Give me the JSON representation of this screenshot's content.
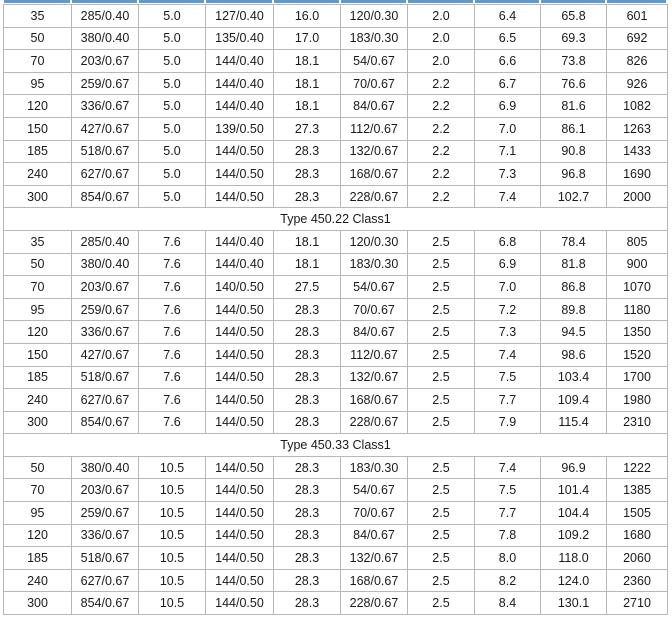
{
  "sections": [
    {
      "title": "",
      "rows": [
        [
          "35",
          "285/0.40",
          "5.0",
          "127/0.40",
          "16.0",
          "120/0.30",
          "2.0",
          "6.4",
          "65.8",
          "601"
        ],
        [
          "50",
          "380/0.40",
          "5.0",
          "135/0.40",
          "17.0",
          "183/0.30",
          "2.0",
          "6.5",
          "69.3",
          "692"
        ],
        [
          "70",
          "203/0.67",
          "5.0",
          "144/0.40",
          "18.1",
          "54/0.67",
          "2.0",
          "6.6",
          "73.8",
          "826"
        ],
        [
          "95",
          "259/0.67",
          "5.0",
          "144/0.40",
          "18.1",
          "70/0.67",
          "2.2",
          "6.7",
          "76.6",
          "926"
        ],
        [
          "120",
          "336/0.67",
          "5.0",
          "144/0.40",
          "18.1",
          "84/0.67",
          "2.2",
          "6.9",
          "81.6",
          "1082"
        ],
        [
          "150",
          "427/0.67",
          "5.0",
          "139/0.50",
          "27.3",
          "112/0.67",
          "2.2",
          "7.0",
          "86.1",
          "1263"
        ],
        [
          "185",
          "518/0.67",
          "5.0",
          "144/0.50",
          "28.3",
          "132/0.67",
          "2.2",
          "7.1",
          "90.8",
          "1433"
        ],
        [
          "240",
          "627/0.67",
          "5.0",
          "144/0.50",
          "28.3",
          "168/0.67",
          "2.2",
          "7.3",
          "96.8",
          "1690"
        ],
        [
          "300",
          "854/0.67",
          "5.0",
          "144/0.50",
          "28.3",
          "228/0.67",
          "2.2",
          "7.4",
          "102.7",
          "2000"
        ]
      ]
    },
    {
      "title": "Type 450.22 Class1",
      "rows": [
        [
          "35",
          "285/0.40",
          "7.6",
          "144/0.40",
          "18.1",
          "120/0.30",
          "2.5",
          "6.8",
          "78.4",
          "805"
        ],
        [
          "50",
          "380/0.40",
          "7.6",
          "144/0.40",
          "18.1",
          "183/0.30",
          "2.5",
          "6.9",
          "81.8",
          "900"
        ],
        [
          "70",
          "203/0.67",
          "7.6",
          "140/0.50",
          "27.5",
          "54/0.67",
          "2.5",
          "7.0",
          "86.8",
          "1070"
        ],
        [
          "95",
          "259/0.67",
          "7.6",
          "144/0.50",
          "28.3",
          "70/0.67",
          "2.5",
          "7.2",
          "89.8",
          "1180"
        ],
        [
          "120",
          "336/0.67",
          "7.6",
          "144/0.50",
          "28.3",
          "84/0.67",
          "2.5",
          "7.3",
          "94.5",
          "1350"
        ],
        [
          "150",
          "427/0.67",
          "7.6",
          "144/0.50",
          "28.3",
          "112/0.67",
          "2.5",
          "7.4",
          "98.6",
          "1520"
        ],
        [
          "185",
          "518/0.67",
          "7.6",
          "144/0.50",
          "28.3",
          "132/0.67",
          "2.5",
          "7.5",
          "103.4",
          "1700"
        ],
        [
          "240",
          "627/0.67",
          "7.6",
          "144/0.50",
          "28.3",
          "168/0.67",
          "2.5",
          "7.7",
          "109.4",
          "1980"
        ],
        [
          "300",
          "854/0.67",
          "7.6",
          "144/0.50",
          "28.3",
          "228/0.67",
          "2.5",
          "7.9",
          "115.4",
          "2310"
        ]
      ]
    },
    {
      "title": "Type 450.33 Class1",
      "rows": [
        [
          "50",
          "380/0.40",
          "10.5",
          "144/0.50",
          "28.3",
          "183/0.30",
          "2.5",
          "7.4",
          "96.9",
          "1222"
        ],
        [
          "70",
          "203/0.67",
          "10.5",
          "144/0.50",
          "28.3",
          "54/0.67",
          "2.5",
          "7.5",
          "101.4",
          "1385"
        ],
        [
          "95",
          "259/0.67",
          "10.5",
          "144/0.50",
          "28.3",
          "70/0.67",
          "2.5",
          "7.7",
          "104.4",
          "1505"
        ],
        [
          "120",
          "336/0.67",
          "10.5",
          "144/0.50",
          "28.3",
          "84/0.67",
          "2.5",
          "7.8",
          "109.2",
          "1680"
        ],
        [
          "185",
          "518/0.67",
          "10.5",
          "144/0.50",
          "28.3",
          "132/0.67",
          "2.5",
          "8.0",
          "118.0",
          "2060"
        ],
        [
          "240",
          "627/0.67",
          "10.5",
          "144/0.50",
          "28.3",
          "168/0.67",
          "2.5",
          "8.2",
          "124.0",
          "2360"
        ],
        [
          "300",
          "854/0.67",
          "10.5",
          "144/0.50",
          "28.3",
          "228/0.67",
          "2.5",
          "8.4",
          "130.1",
          "2710"
        ]
      ]
    }
  ],
  "colors": {
    "header_accent": "#5b9bd5",
    "grid_line": "#b7b7b7",
    "text": "#1a1a1a"
  }
}
